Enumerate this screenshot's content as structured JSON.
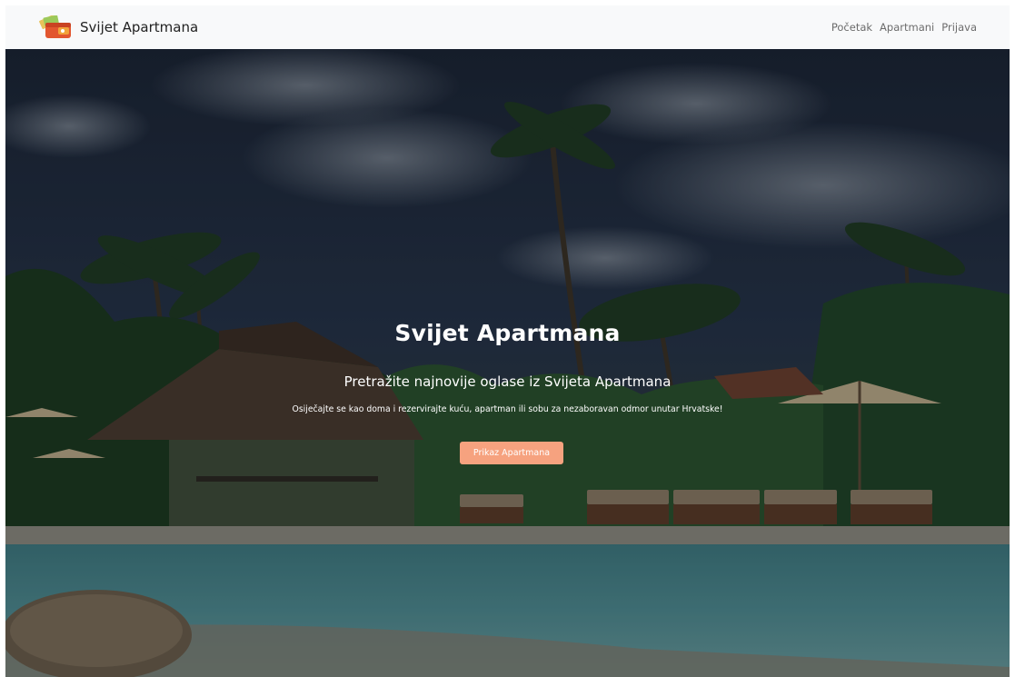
{
  "navbar": {
    "brand_name": "Svijet Apartmana",
    "brand_icon": "wallet-logo-icon",
    "links": [
      {
        "label": "Početak"
      },
      {
        "label": "Apartmani"
      },
      {
        "label": "Prijava"
      }
    ]
  },
  "hero": {
    "title": "Svijet Apartmana",
    "subtitle": "Pretražite najnovije oglase iz Svijeta Apartmana",
    "text": "Osiječajte se kao doma i rezervirajte kuću, apartman ili sobu za nezaboravan odmor unutar Hrvatske!",
    "button_label": "Prikaz Apartmana",
    "background": "resort-pool-palm-trees-photo"
  },
  "colors": {
    "navbar_bg": "#f8f9fa",
    "button_bg": "#f6a27f",
    "button_text": "#ffffff",
    "nav_link": "#6c6c6c"
  }
}
